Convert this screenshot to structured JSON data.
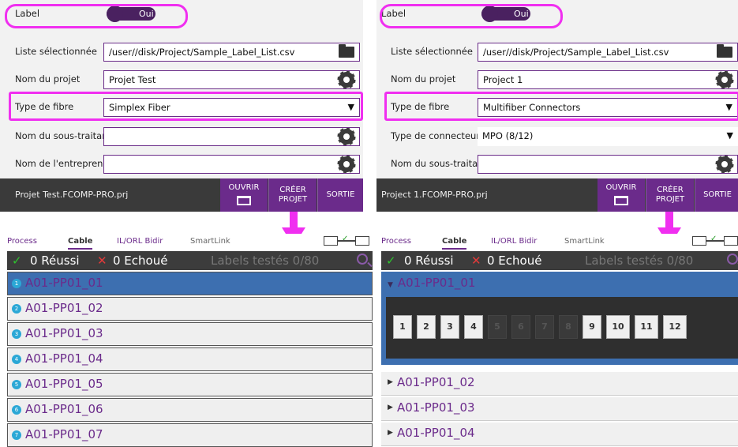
{
  "left_form": {
    "label_field": "Label",
    "label_toggle": "Oui",
    "list_label": "Liste sélectionnée",
    "list_value": "/user//disk/Project/Sample_Label_List.csv",
    "project_label": "Nom du projet",
    "project_value": "Projet Test",
    "fiber_label": "Type de fibre",
    "fiber_value": "Simplex Fiber",
    "sub_label": "Nom du sous-traitan",
    "sub_value": "",
    "company_label": "Nom de l'entreprene",
    "company_value": "",
    "footer_file": "Projet Test.FCOMP-PRO.prj",
    "btn_open": "OUVRIR",
    "btn_create": "CRÉER PROJET",
    "btn_exit": "SORTIE"
  },
  "right_form": {
    "label_field": "Label",
    "label_toggle": "Oui",
    "list_label": "Liste sélectionnée",
    "list_value": "/user//disk/Project/Sample_Label_List.csv",
    "project_label": "Nom du projet",
    "project_value": "Project 1",
    "fiber_label": "Type de fibre",
    "fiber_value": "Multifiber Connectors",
    "connector_label": "Type de connecteur",
    "connector_value": "MPO (8/12)",
    "sub_label": "Nom du sous-traitan",
    "sub_value": "",
    "footer_file": "Project 1.FCOMP-PRO.prj",
    "btn_open": "OUVRIR",
    "btn_create": "CRÉER PROJET",
    "btn_exit": "SORTIE"
  },
  "tabs": [
    "Process",
    "Cable",
    "IL/ORL Bidir",
    "SmartLink"
  ],
  "status": {
    "passed": "0 Réussi",
    "failed": "0 Echoué",
    "tested": "Labels testés 0/80"
  },
  "left_list": {
    "items": [
      {
        "num": "1",
        "label": "A01-PP01_01"
      },
      {
        "num": "2",
        "label": "A01-PP01_02"
      },
      {
        "num": "3",
        "label": "A01-PP01_03"
      },
      {
        "num": "4",
        "label": "A01-PP01_04"
      },
      {
        "num": "5",
        "label": "A01-PP01_05"
      },
      {
        "num": "6",
        "label": "A01-PP01_06"
      },
      {
        "num": "7",
        "label": "A01-PP01_07"
      }
    ]
  },
  "right_list": {
    "expanded": "A01-PP01_01",
    "fibers": [
      "1",
      "2",
      "3",
      "4",
      "5",
      "6",
      "7",
      "8",
      "9",
      "10",
      "11",
      "12"
    ],
    "items": [
      "A01-PP01_02",
      "A01-PP01_03",
      "A01-PP01_04"
    ]
  },
  "colors": {
    "accent": "#6b2b8b",
    "highlight": "#f02ff0",
    "selected": "#3d6fb0",
    "ok": "#2ec32e",
    "fail": "#e23a3a"
  }
}
